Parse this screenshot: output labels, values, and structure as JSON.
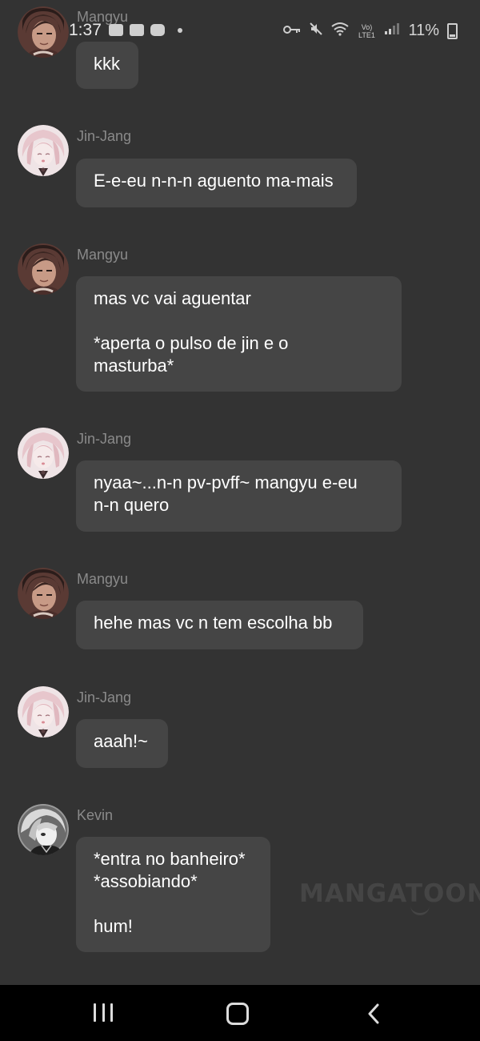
{
  "status_bar": {
    "time": "1:37",
    "battery": "11%",
    "network_label": "Vo) LTE1"
  },
  "messages": [
    {
      "sender": "Mangyu",
      "avatar": "mangyu",
      "text": "kkk"
    },
    {
      "sender": "Jin-Jang",
      "avatar": "jinjang",
      "text": "E-e-eu n-n-n aguento ma-mais"
    },
    {
      "sender": "Mangyu",
      "avatar": "mangyu",
      "text": "mas vc vai aguentar\n\n*aperta o pulso de jin e o\nmasturba*"
    },
    {
      "sender": "Jin-Jang",
      "avatar": "jinjang",
      "text": "nyaa~...n-n pv-pvff~ mangyu e-eu\nn-n quero"
    },
    {
      "sender": "Mangyu",
      "avatar": "mangyu",
      "text": "hehe mas vc n tem escolha bb"
    },
    {
      "sender": "Jin-Jang",
      "avatar": "jinjang",
      "text": "aaah!~"
    },
    {
      "sender": "Kevin",
      "avatar": "kevin",
      "text": "*entra no banheiro*\n*assobiando*\n\nhum!"
    }
  ],
  "watermark": "MANGATOON",
  "colors": {
    "background": "#333333",
    "bubble": "#454545",
    "sender_name": "#8a8a8a",
    "nav_bar": "#000000"
  },
  "nav": {
    "recents": "recents-icon",
    "home": "home-icon",
    "back": "back-icon"
  }
}
